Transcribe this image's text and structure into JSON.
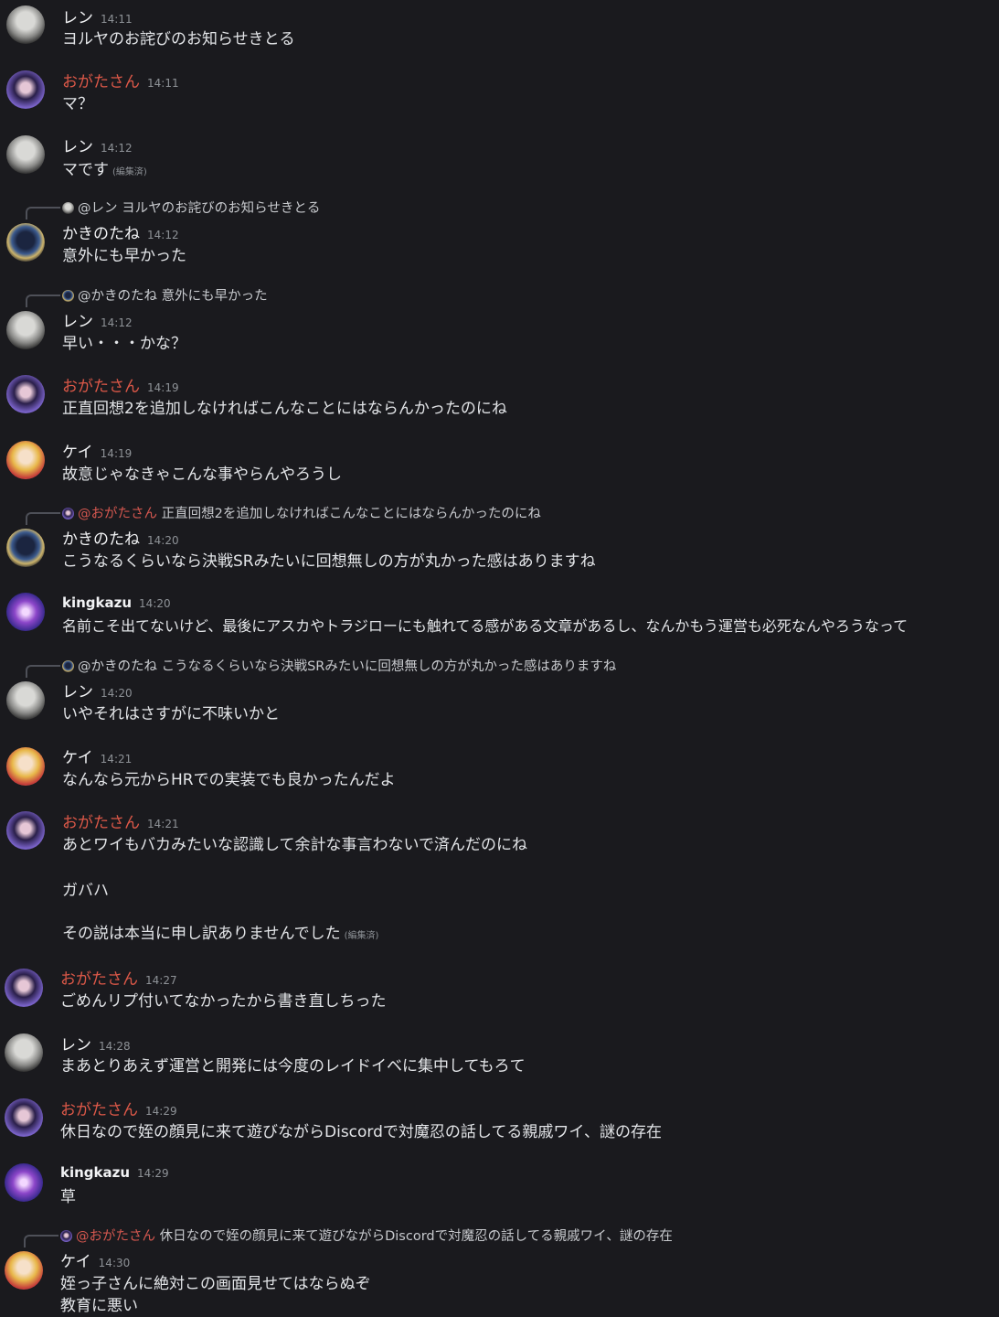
{
  "messages": [
    {
      "author": "レン",
      "time": "14:11",
      "text": "ヨルヤのお詫びのお知らせきとる"
    },
    {
      "author": "おがたさん",
      "time": "14:11",
      "text": "マ？"
    },
    {
      "author": "レン",
      "time": "14:12",
      "text": "マです",
      "edited": "(編集済)"
    },
    {
      "reply_mention": "@レン",
      "reply_text": "ヨルヤのお詫びのお知らせきとる",
      "author": "かきのたね",
      "time": "14:12",
      "text": "意外にも早かった"
    },
    {
      "reply_mention": "@かきのたね",
      "reply_text": "意外にも早かった",
      "author": "レン",
      "time": "14:12",
      "text": "早い・・・かな？"
    },
    {
      "author": "おがたさん",
      "time": "14:19",
      "text": "正直回想2を追加しなければこんなことにはならんかったのにね"
    },
    {
      "author": "ケイ",
      "time": "14:19",
      "text": "故意じゃなきゃこんな事やらんやろうし"
    },
    {
      "reply_mention": "@おがたさん",
      "reply_text": "正直回想2を追加しなければこんなことにはならんかったのにね",
      "author": "かきのたね",
      "time": "14:20",
      "text": "こうなるくらいなら決戦SRみたいに回想無しの方が丸かった感はありますね"
    },
    {
      "author": "kingkazu",
      "time": "14:20",
      "text": "名前こそ出てないけど、最後にアスカやトラジローにも触れてる感がある文章があるし、なんかもう運営も必死なんやろうなって"
    },
    {
      "reply_mention": "@かきのたね",
      "reply_text": "こうなるくらいなら決戦SRみたいに回想無しの方が丸かった感はありますね",
      "author": "レン",
      "time": "14:20",
      "text": "いやそれはさすがに不味いかと"
    },
    {
      "author": "ケイ",
      "time": "14:21",
      "text": "なんなら元からHRでの実装でも良かったんだよ"
    },
    {
      "author": "おがたさん",
      "time": "14:21",
      "text": "あとワイもバカみたいな認識して余計な事言わないで済んだのにね",
      "line2": "ガバハ",
      "line3": "その説は本当に申し訳ありませんでした",
      "edited": "(編集済)"
    },
    {
      "author": "おがたさん",
      "time": "14:27",
      "text": "ごめんリプ付いてなかったから書き直しちった"
    },
    {
      "author": "レン",
      "time": "14:28",
      "text": "まあとりあえず運営と開発には今度のレイドイベに集中してもろて"
    },
    {
      "author": "おがたさん",
      "time": "14:29",
      "text": "休日なので姪の顔見に来て遊びながらDiscordで対魔忍の話してる親戚ワイ、謎の存在"
    },
    {
      "author": "kingkazu",
      "time": "14:29",
      "text": "草"
    },
    {
      "reply_mention": "@おがたさん",
      "reply_text": "休日なので姪の顔見に来て遊びながらDiscordで対魔忍の話してる親戚ワイ、謎の存在",
      "author": "ケイ",
      "time": "14:30",
      "text": "姪っ子さんに絶対この画面見せてはならぬぞ",
      "line2": "教育に悪い"
    }
  ]
}
